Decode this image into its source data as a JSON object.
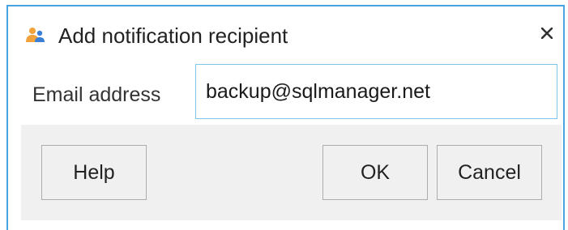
{
  "dialog": {
    "title": "Add notification recipient",
    "title_icon": "users-icon",
    "close_icon": "close-icon"
  },
  "form": {
    "email_label": "Email address",
    "email_value": "backup@sqlmanager.net"
  },
  "buttons": {
    "help": "Help",
    "ok": "OK",
    "cancel": "Cancel"
  },
  "colors": {
    "border_accent": "#4aa3df",
    "input_focus_border": "#7ec3e8",
    "footer_background": "#f0f0f0"
  }
}
